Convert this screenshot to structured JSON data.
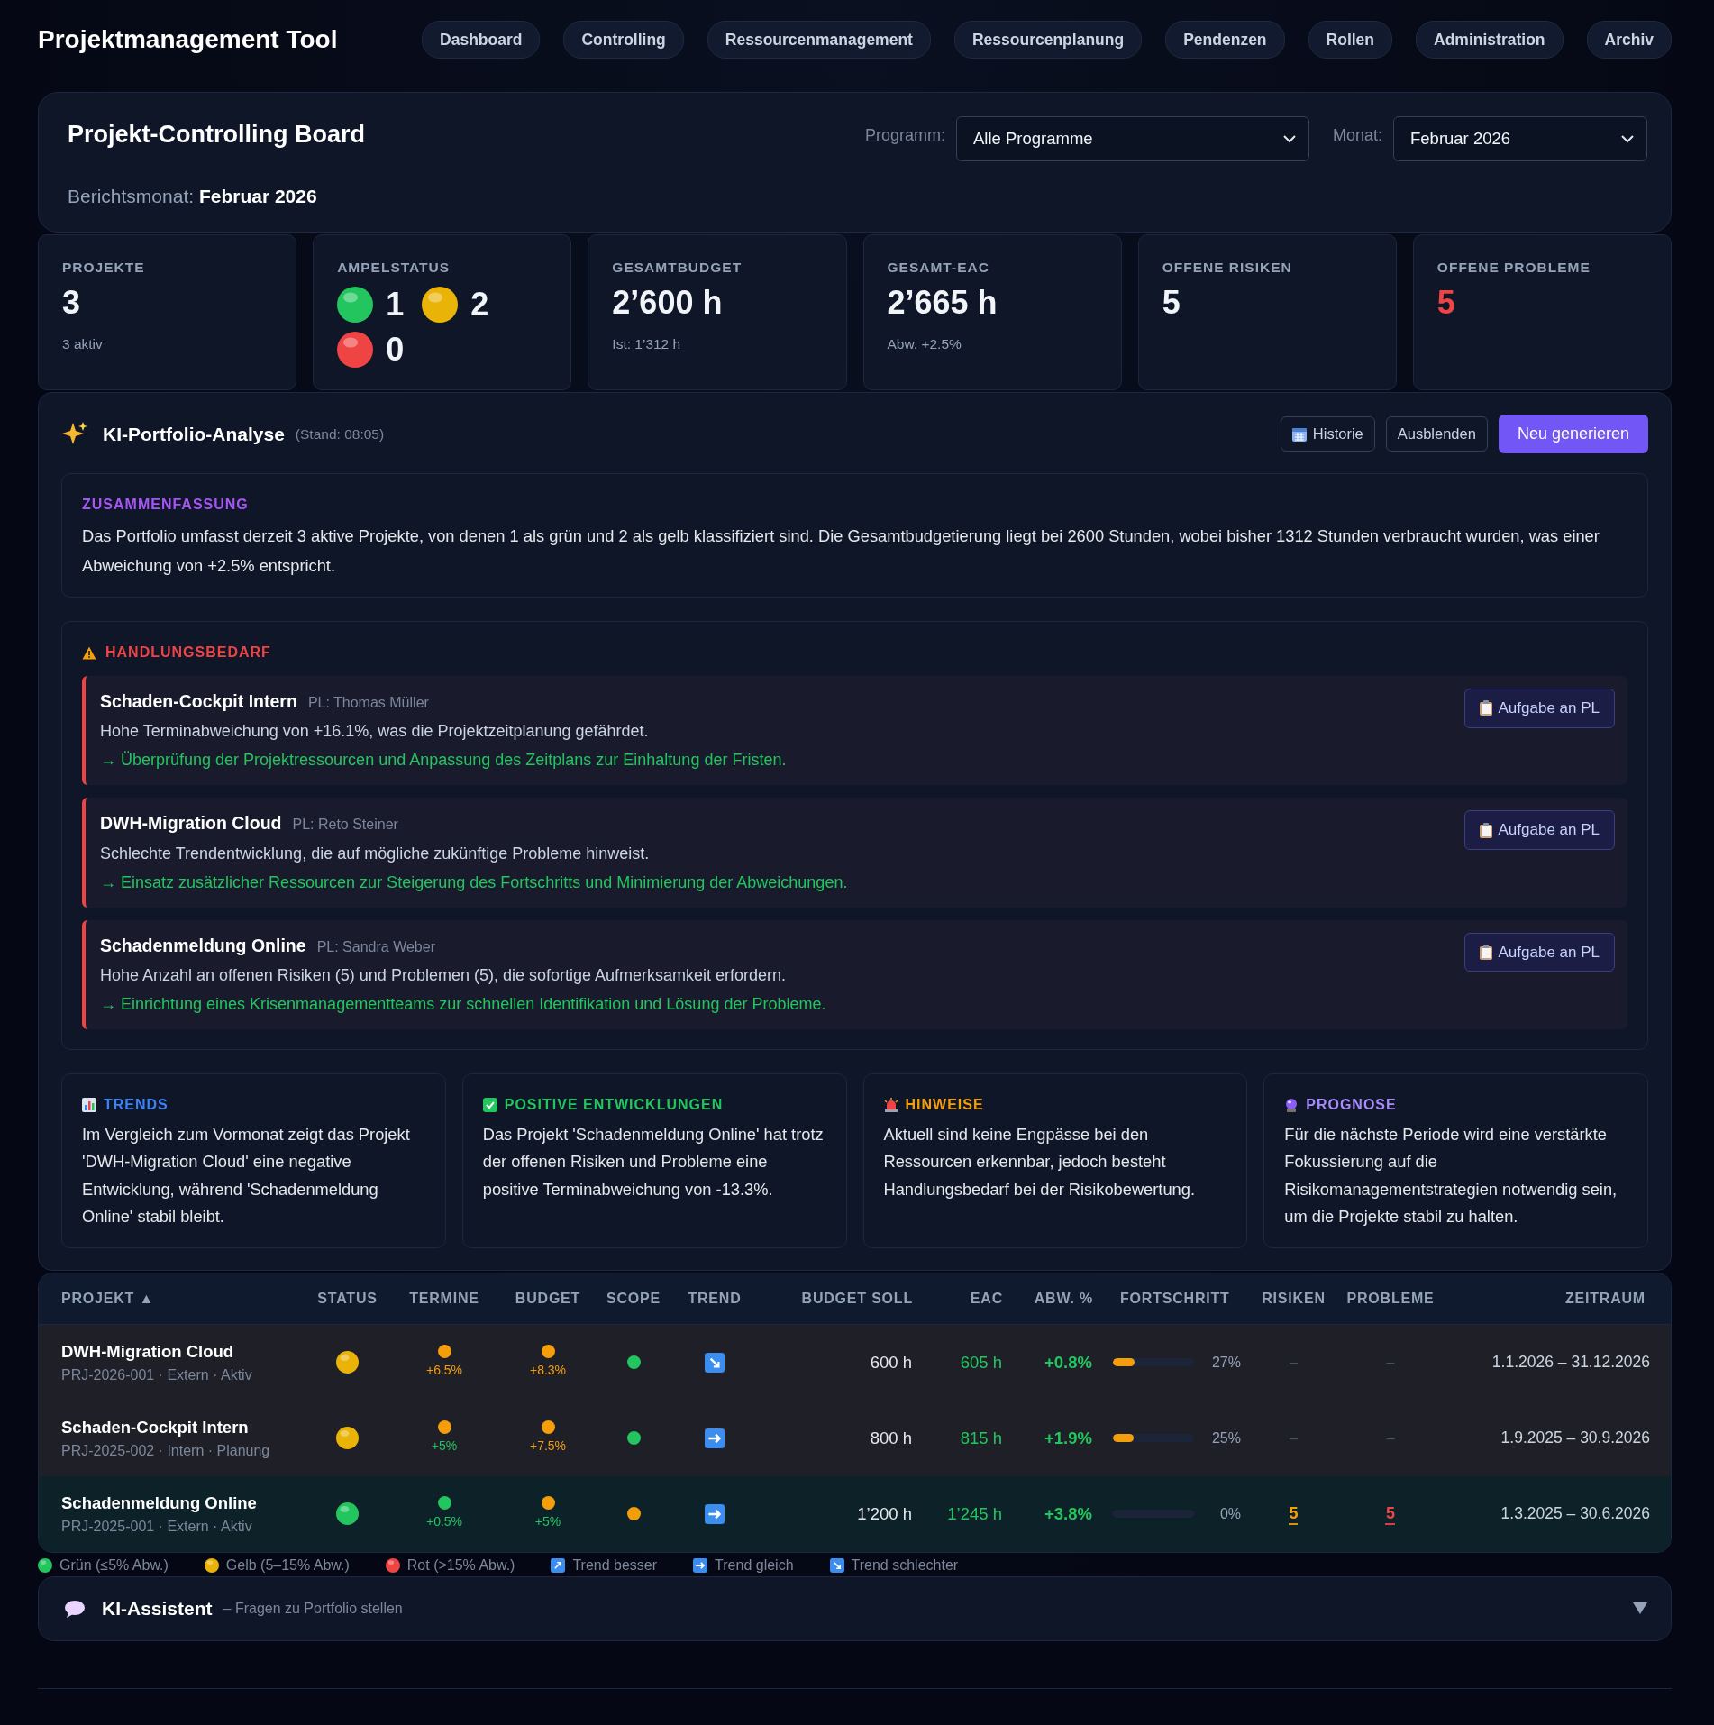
{
  "app_title": "Projektmanagement Tool",
  "nav": [
    {
      "label": "Dashboard",
      "selected": false
    },
    {
      "label": "Controlling",
      "selected": false
    },
    {
      "label": "Ressourcenmanagement",
      "selected": false
    },
    {
      "label": "Ressourcenplanung",
      "selected": false
    },
    {
      "label": "Pendenzen",
      "selected": false
    },
    {
      "label": "Rollen",
      "selected": false
    },
    {
      "label": "Administration",
      "selected": false
    },
    {
      "label": "Archiv",
      "selected": false
    }
  ],
  "header": {
    "title": "Projekt-Controlling Board",
    "report": "Berichtsmonat: **Februar 2026**",
    "filters": [
      {
        "label": "Programm:",
        "value": "Alle Programme"
      },
      {
        "label": "Monat:",
        "value": "Februar 2026"
      }
    ]
  },
  "kpis": [
    {
      "kind": "number",
      "label": "PROJEKTE",
      "value": "3",
      "sub": "3 aktiv",
      "alert": false
    },
    {
      "kind": "lights",
      "label": "AMPELSTATUS",
      "lights": [
        {
          "color": "#22c55e",
          "count": "1"
        },
        {
          "color": "#eab308",
          "count": "2"
        },
        {
          "color": "#ef4444",
          "count": "0"
        }
      ]
    },
    {
      "kind": "number",
      "label": "GESAMTBUDGET",
      "value": "2’600 h",
      "sub": "Ist: 1’312 h",
      "alert": false
    },
    {
      "kind": "number",
      "label": "GESAMT-EAC",
      "value": "2’665 h",
      "sub": "Abw. +2.5%",
      "alert": false
    },
    {
      "kind": "number",
      "label": "OFFENE RISIKEN",
      "value": "5",
      "alert": false
    },
    {
      "kind": "number",
      "label": "OFFENE PROBLEME",
      "value": "5",
      "alert": true
    }
  ],
  "ai_analysis": {
    "title": "KI-Portfolio-Analyse",
    "stand": "(Stand: 08:05)",
    "buttons": [
      {
        "kind": "calendar",
        "label": "Historie"
      },
      {
        "kind": "outline",
        "label": "Ausblenden"
      },
      {
        "kind": "primary",
        "label": "Neu generieren"
      }
    ],
    "summary": {
      "heading": "ZUSAMMENFASSUNG",
      "text": "Das Portfolio umfasst derzeit 3 aktive Projekte, von denen 1 als grün und 2 als gelb klassifiziert sind. Die Gesamtbudgetierung liegt bei 2600 Stunden, wobei bisher 1312 Stunden verbraucht wurden, was einer Abweichung von +2.5% entspricht."
    },
    "action": {
      "heading": "HANDLUNGSBEDARF",
      "items": [
        {
          "project": "Schaden-Cockpit Intern",
          "pl": "PL: Thomas Müller",
          "issue": "Hohe Terminabweichung von +16.1%, was die Projektzeitplanung gefährdet.",
          "recommendation": "→ Überprüfung der Projektressourcen und Anpassung des Zeitplans zur Einhaltung der Fristen.",
          "button": "Aufgabe an PL"
        },
        {
          "project": "DWH-Migration Cloud",
          "pl": "PL: Reto Steiner",
          "issue": "Schlechte Trendentwicklung, die auf mögliche zukünftige Probleme hinweist.",
          "recommendation": "→ Einsatz zusätzlicher Ressourcen zur Steigerung des Fortschritts und Minimierung der Abweichungen.",
          "button": "Aufgabe an PL"
        },
        {
          "project": "Schadenmeldung Online",
          "pl": "PL: Sandra Weber",
          "issue": "Hohe Anzahl an offenen Risiken (5) und Problemen (5), die sofortige Aufmerksamkeit erfordern.",
          "recommendation": "→ Einrichtung eines Krisenmanagementteams zur schnellen Identifikation und Lösung der Probleme.",
          "button": "Aufgabe an PL"
        }
      ]
    },
    "insights": [
      {
        "kind": "trends",
        "heading": "TRENDS",
        "text": "Im Vergleich zum Vormonat zeigt das Projekt 'DWH-Migration Cloud' eine negative Entwicklung, während 'Schadenmeldung Online' stabil bleibt."
      },
      {
        "kind": "positive",
        "heading": "POSITIVE ENTWICKLUNGEN",
        "text": "Das Projekt 'Schadenmeldung Online' hat trotz der offenen Risiken und Probleme eine positive Terminabweichung von -13.3%."
      },
      {
        "kind": "hints",
        "heading": "HINWEISE",
        "text": "Aktuell sind keine Engpässe bei den Ressourcen erkennbar, jedoch besteht Handlungsbedarf bei der Risikobewertung."
      },
      {
        "kind": "forecast",
        "heading": "PROGNOSE",
        "text": "Für die nächste Periode wird eine verstärkte Fokussierung auf die Risikomanagementstrategien notwendig sein, um die Projekte stabil zu halten."
      }
    ]
  },
  "table": {
    "columns": [
      {
        "label": "PROJEKT",
        "sort_mark": "▲"
      },
      {
        "label": "STATUS"
      },
      {
        "label": "TERMINE"
      },
      {
        "label": "BUDGET"
      },
      {
        "label": "SCOPE"
      },
      {
        "label": "TREND"
      },
      {
        "label": "BUDGET SOLL"
      },
      {
        "label": "EAC"
      },
      {
        "label": "ABW. %"
      },
      {
        "label": "FORTSCHRITT"
      },
      {
        "label": "RISIKEN"
      },
      {
        "label": "PROBLEME"
      },
      {
        "label": "ZEITRAUM"
      }
    ],
    "rows": [
      {
        "selected": false,
        "name": "DWH-Migration Cloud",
        "meta": "PRJ-2026-001 · Extern · Aktiv",
        "status": {
          "color": "#eab308"
        },
        "termine": {
          "color": "#f59e0b",
          "label": {
            "text": "+6.5%",
            "color": "#f59e0b"
          }
        },
        "budget": {
          "color": "#f59e0b",
          "label": {
            "text": "+8.3%",
            "color": "#f59e0b"
          }
        },
        "scope": {
          "color": "#22c55e"
        },
        "trend": {
          "kind": "worse"
        },
        "budget_soll": "600 h",
        "eac": "605 h",
        "abw": "+0.8%",
        "progress": {
          "level": 0.27,
          "label": "27%"
        },
        "risiken": {
          "value": "–",
          "color": "#475569"
        },
        "probleme": {
          "value": "–",
          "color": "#475569"
        },
        "zeitraum": "1.1.2026 – 31.12.2026"
      },
      {
        "selected": false,
        "name": "Schaden-Cockpit Intern",
        "meta": "PRJ-2025-002 · Intern · Planung",
        "status": {
          "color": "#eab308"
        },
        "termine": {
          "color": "#f59e0b",
          "label": {
            "text": "+5%",
            "color": "#22c55e"
          }
        },
        "budget": {
          "color": "#f59e0b",
          "label": {
            "text": "+7.5%",
            "color": "#f59e0b"
          }
        },
        "scope": {
          "color": "#22c55e"
        },
        "trend": {
          "kind": "same"
        },
        "budget_soll": "800 h",
        "eac": "815 h",
        "abw": "+1.9%",
        "progress": {
          "level": 0.25,
          "label": "25%"
        },
        "risiken": {
          "value": "–",
          "color": "#475569"
        },
        "probleme": {
          "value": "–",
          "color": "#475569"
        },
        "zeitraum": "1.9.2025 – 30.9.2026"
      },
      {
        "selected": true,
        "name": "Schadenmeldung Online",
        "meta": "PRJ-2025-001 · Extern · Aktiv",
        "status": {
          "color": "#22c55e"
        },
        "termine": {
          "color": "#22c55e",
          "label": {
            "text": "+0.5%",
            "color": "#22c55e"
          }
        },
        "budget": {
          "color": "#f59e0b",
          "label": {
            "text": "+5%",
            "color": "#22c55e"
          }
        },
        "scope": {
          "color": "#f59e0b"
        },
        "trend": {
          "kind": "same"
        },
        "budget_soll": "1’200 h",
        "eac": "1’245 h",
        "abw": "+3.8%",
        "progress": {
          "level": 0,
          "label": "0%"
        },
        "risiken": {
          "value": "5",
          "color": "#f59e0b"
        },
        "probleme": {
          "value": "5",
          "color": "#ef4444"
        },
        "zeitraum": "1.3.2025 – 30.6.2026"
      }
    ]
  },
  "legend": [
    {
      "kind": "dot",
      "color": "#22c55e",
      "label": "Grün (≤5% Abw.)"
    },
    {
      "kind": "dot",
      "color": "#eab308",
      "label": "Gelb (5–15% Abw.)"
    },
    {
      "kind": "dot",
      "color": "#ef4444",
      "label": "Rot (>15% Abw.)"
    },
    {
      "kind": "trend_better",
      "label": "Trend besser"
    },
    {
      "kind": "trend_same",
      "label": "Trend gleich"
    },
    {
      "kind": "trend_worse",
      "label": "Trend schlechter"
    }
  ],
  "assistant": {
    "title": "KI-Assistent",
    "subtitle": "– Fragen zu Portfolio stellen",
    "expanded": false
  }
}
